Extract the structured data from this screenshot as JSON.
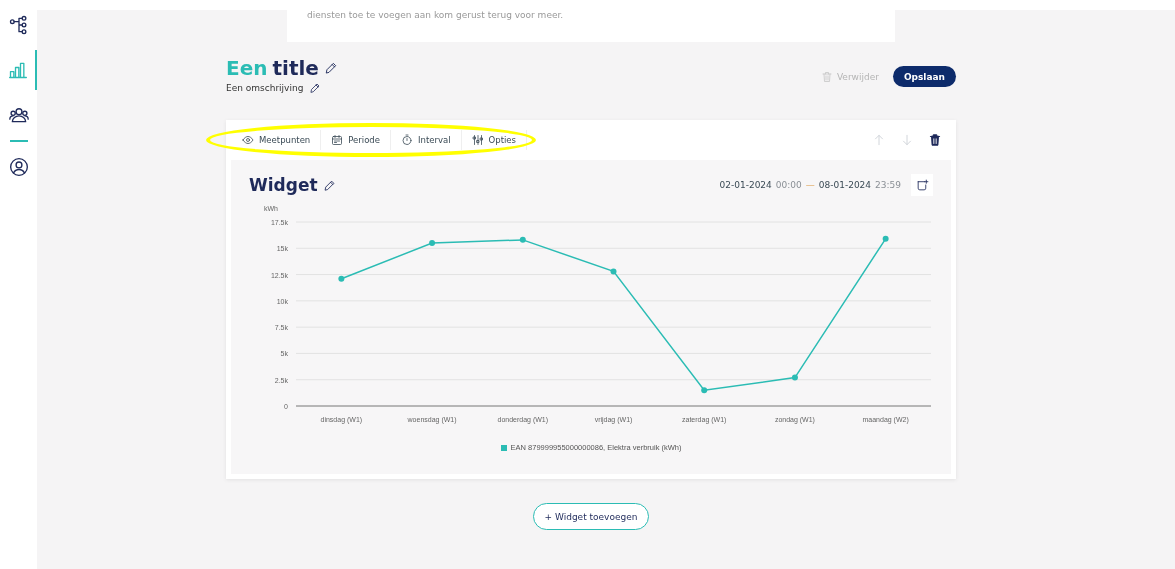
{
  "sidebar": {
    "items": [
      {
        "selected": false
      },
      {
        "selected": true
      },
      {
        "selected": false
      },
      {
        "selected": false
      }
    ]
  },
  "top_card": {
    "text": "diensten toe te voegen aan kom gerust terug voor meer."
  },
  "dashboard": {
    "title_first": "Een",
    "title_rest": "title",
    "description": "Een omschrijving",
    "delete_label": "Verwijder",
    "delete_disabled": true,
    "save_label": "Opslaan"
  },
  "toolbar": {
    "tabs": [
      {
        "label": "Meetpunten"
      },
      {
        "label": "Periode"
      },
      {
        "label": "Interval"
      },
      {
        "label": "Opties"
      }
    ],
    "move_up_disabled": true,
    "move_down_disabled": true
  },
  "annotation": {
    "kind": "ellipse",
    "color": "#ffff00"
  },
  "widget": {
    "title": "Widget",
    "range_start_date": "02-01-2024",
    "range_start_time": "00:00",
    "range_sep": "—",
    "range_end_date": "08-01-2024",
    "range_end_time": "23:59",
    "chart_data": {
      "type": "line",
      "grid": true,
      "ylabel": "kWh",
      "categories": [
        "dinsdag (W1)",
        "woensdag (W1)",
        "donderdag (W1)",
        "vrijdag (W1)",
        "zaterdag (W1)",
        "zondag (W1)",
        "maandag (W2)"
      ],
      "series": [
        {
          "name": "EAN 879999955000000086, Elektra verbruik (kWh)",
          "color": "#2bbcb4",
          "marker": true,
          "values": [
            12100,
            15500,
            15800,
            12800,
            1500,
            2700,
            15900
          ]
        }
      ],
      "ylim": [
        0,
        17500
      ],
      "yticks": [
        {
          "value": 0,
          "label": "0"
        },
        {
          "value": 2500,
          "label": "2.5k"
        },
        {
          "value": 5000,
          "label": "5k"
        },
        {
          "value": 7500,
          "label": "7.5k"
        },
        {
          "value": 10000,
          "label": "10k"
        },
        {
          "value": 12500,
          "label": "12.5k"
        },
        {
          "value": 15000,
          "label": "15k"
        },
        {
          "value": 17500,
          "label": "17.5k"
        }
      ]
    }
  },
  "add_widget_label": "+ Widget toevoegen"
}
